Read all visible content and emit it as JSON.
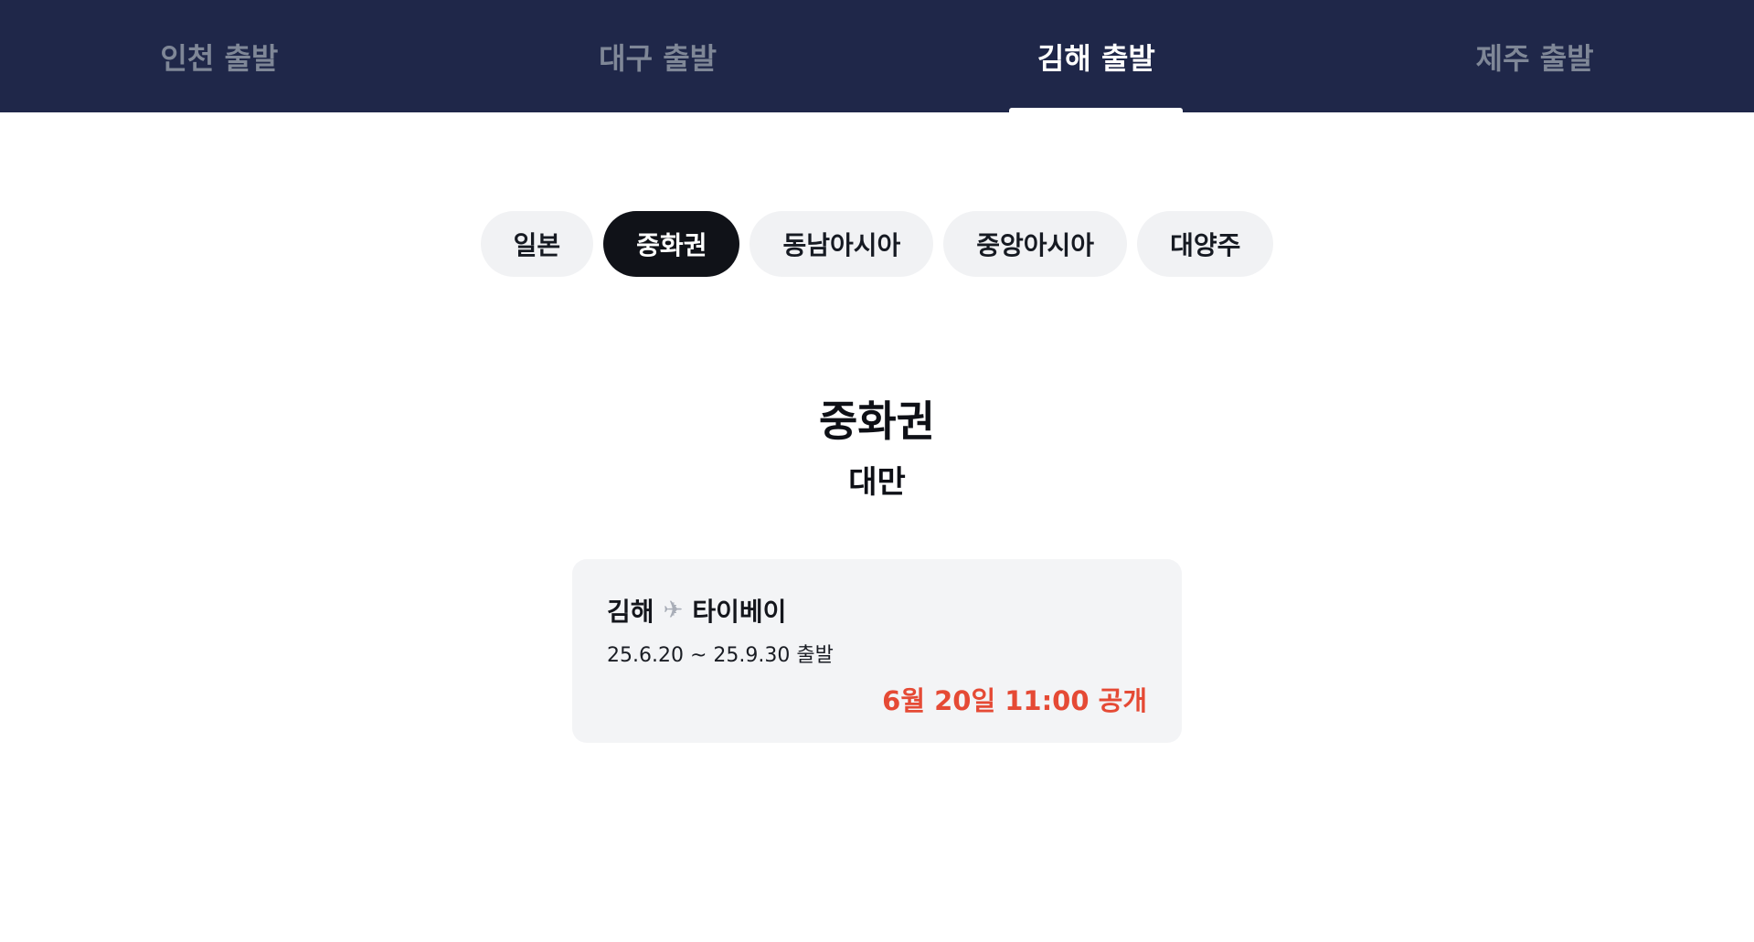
{
  "departure_tabs": [
    {
      "label": "인천 출발",
      "active": false
    },
    {
      "label": "대구 출발",
      "active": false
    },
    {
      "label": "김해 출발",
      "active": true
    },
    {
      "label": "제주 출발",
      "active": false
    }
  ],
  "region_chips": [
    {
      "label": "일본",
      "active": false
    },
    {
      "label": "중화권",
      "active": true
    },
    {
      "label": "동남아시아",
      "active": false
    },
    {
      "label": "중앙아시아",
      "active": false
    },
    {
      "label": "대양주",
      "active": false
    }
  ],
  "section": {
    "title": "중화권",
    "subtitle": "대만"
  },
  "fare_card": {
    "origin": "김해",
    "plane_icon": "✈",
    "destination": "타이베이",
    "period": "25.6.20 ~ 25.9.30 출발",
    "open_time": "6월 20일 11:00 공개"
  },
  "colors": {
    "nav_background": "#1f2749",
    "open_time": "#e54a35",
    "active_chip": "#101218"
  }
}
